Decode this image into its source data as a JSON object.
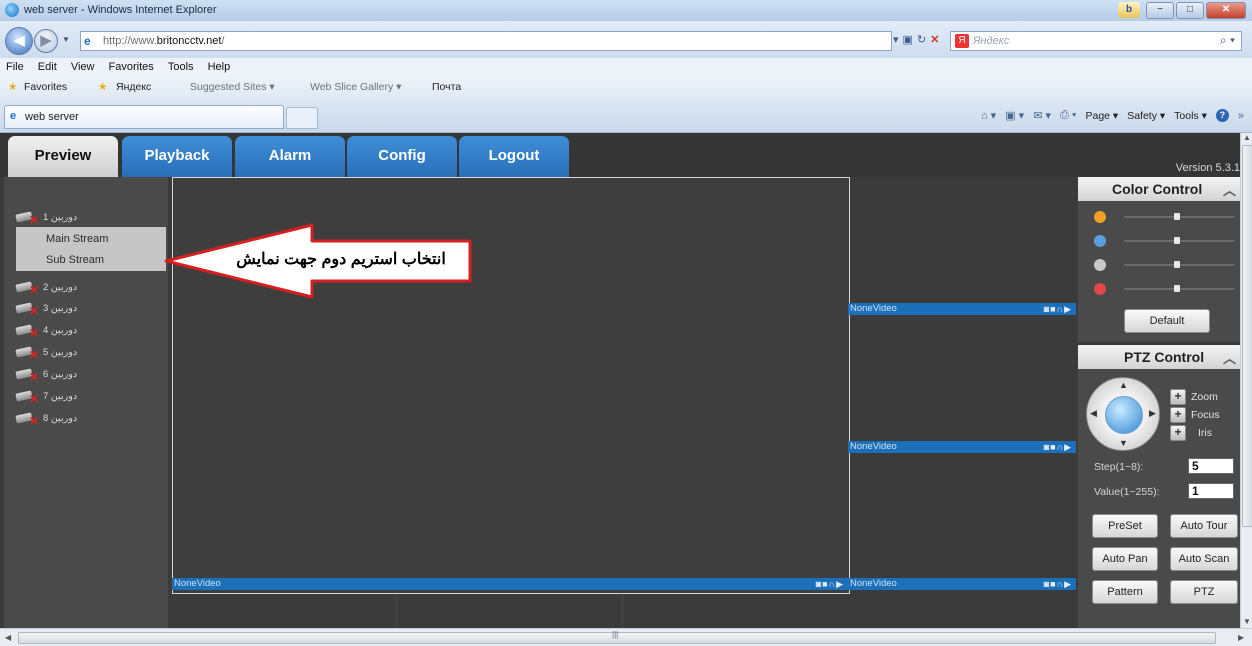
{
  "window": {
    "title": "web server - Windows Internet Explorer",
    "controls": [
      "−",
      "□",
      "✕"
    ],
    "bing_label": "b"
  },
  "address": {
    "url_prefix": "http://www.",
    "url_domain": "britoncctv.net",
    "url_suffix": "/",
    "search_placeholder": "Яндекс",
    "search_provider_icon": "Я"
  },
  "menu": [
    "File",
    "Edit",
    "View",
    "Favorites",
    "Tools",
    "Help"
  ],
  "favorites_bar": {
    "favorites_label": "Favorites",
    "items": [
      "Яндекс",
      "Suggested Sites ▾",
      "Web Slice Gallery ▾",
      "Почта"
    ]
  },
  "tab": {
    "label": "web server"
  },
  "command_bar": [
    "Page ▾",
    "Safety ▾",
    "Tools ▾"
  ],
  "app": {
    "nav_tabs": [
      "Preview",
      "Playback",
      "Alarm",
      "Config",
      "Logout"
    ],
    "active_tab": "Preview",
    "version": "Version 5.3.1",
    "cameras": [
      {
        "label": "دوربین 1"
      },
      {
        "label": "دوربین 2"
      },
      {
        "label": "دوربین 3"
      },
      {
        "label": "دوربین 4"
      },
      {
        "label": "دوربین 5"
      },
      {
        "label": "دوربین 6"
      },
      {
        "label": "دوربین 7"
      },
      {
        "label": "دوربین 8"
      }
    ],
    "streams": [
      "Main Stream",
      "Sub Stream"
    ],
    "annotation": "انتخاب استریم دوم جهت نمایش",
    "video_label": "NoneVideo",
    "video_icons": "◙■∩▶",
    "color_control": {
      "title": "Color Control",
      "icon_colors": [
        "#f0a020",
        "#5aa0e0",
        "#c8c8c8",
        "#e04848"
      ],
      "default_button": "Default"
    },
    "ptz_control": {
      "title": "PTZ Control",
      "zoom_label": "Zoom",
      "focus_label": "Focus",
      "iris_label": "Iris",
      "step_label": "Step(1~8):",
      "step_value": "5",
      "value_label": "Value(1~255):",
      "value_value": "1",
      "buttons": [
        "PreSet",
        "Auto Tour",
        "Auto Pan",
        "Auto Scan",
        "Pattern",
        "PTZ"
      ]
    }
  }
}
